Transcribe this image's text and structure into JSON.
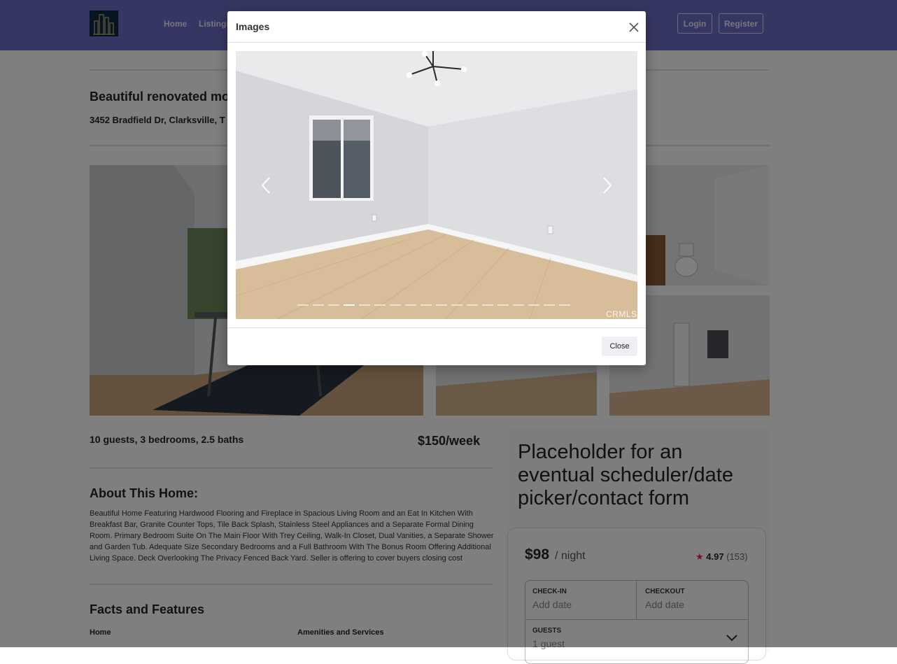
{
  "header": {
    "nav": [
      "Home",
      "Listings"
    ],
    "login_label": "Login",
    "register_label": "Register",
    "bar_color": "#6c6cc8"
  },
  "listing": {
    "title": "Beautiful renovated mo",
    "address": "3452 Bradfield Dr, Clarksville, T",
    "summary": "10 guests, 3 bedrooms, 2.5 baths",
    "price_week": "$150/week",
    "about_title": "About This Home:",
    "about_text": "Beautiful Home Featuring Hardwood Flooring and Fireplace in Spacious Living Room and an Eat In Kitchen With Breakfast Bar, Granite Counter Tops, Tile Back Splash, Stainless Steel Appliances and a Separate Formal Dining Room. Primary Bedroom Suite On The Main Floor With Trey Ceiling, Walk-In Closet, Dual Vanities, a Separate Shower and Garden Tub. Adequate Size Secondary Bedrooms and a Full Bathroom With The Bonus Room Offering Additional Living Space. Deck Overlooking The Privacy Fenced Back Yard. Seller is offering to cover buyers closing cost",
    "facts_title": "Facts and Features",
    "facts_col_home": "Home",
    "facts_col_amenities": "Amenities and Services"
  },
  "booking": {
    "placeholder": "Placeholder for an eventual scheduler/date picker/contact form",
    "price": "$98",
    "unit": "/ night",
    "star": "★",
    "rating": "4.97",
    "reviews": "(153)",
    "checkin_label": "CHECK-IN",
    "checkin_value": "Add date",
    "checkout_label": "CHECKOUT",
    "checkout_value": "Add date",
    "guests_label": "GUESTS",
    "guests_value": "1 guest",
    "rating_color": "#e0245e"
  },
  "modal": {
    "title": "Images",
    "close_label": "Close",
    "watermark": "CRMLS",
    "slide_count": 18,
    "active_slide": 4
  }
}
